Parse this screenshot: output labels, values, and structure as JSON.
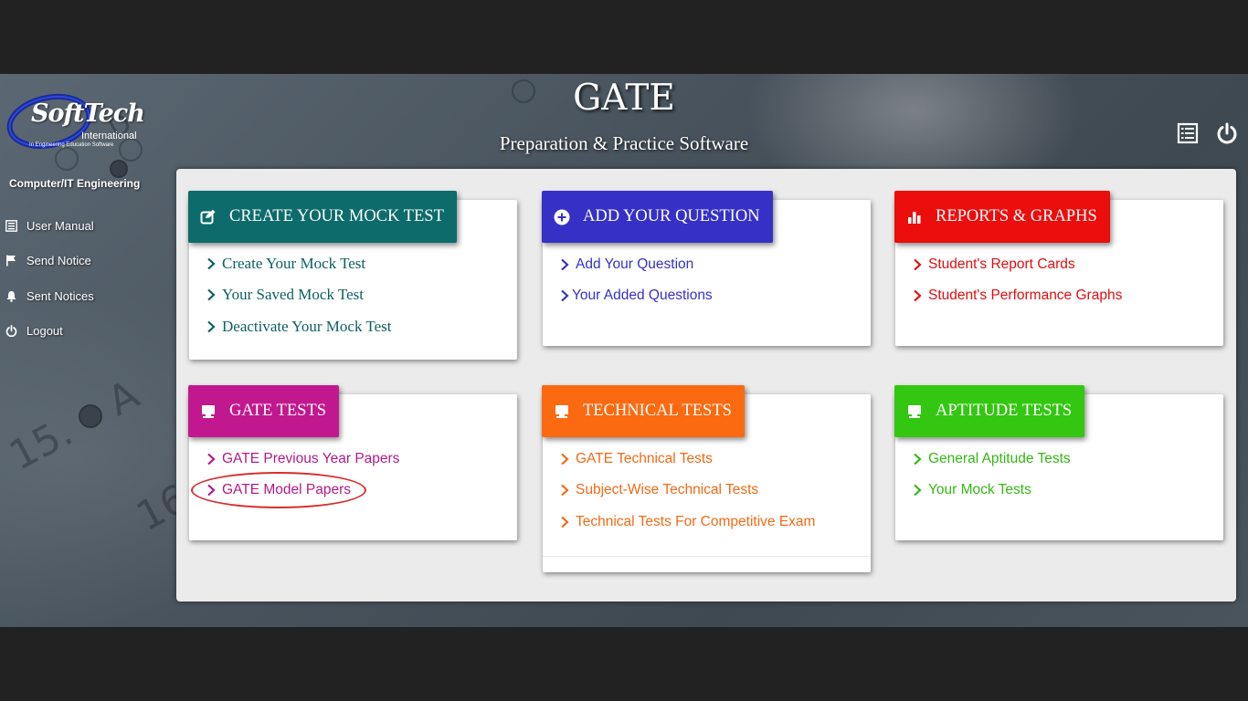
{
  "logo": {
    "title": "SoftTech",
    "subtitle": "International",
    "tagline": "In Engineering Education Software"
  },
  "header": {
    "title": "GATE",
    "subtitle": "Preparation & Practice Software",
    "icons": [
      "list-icon",
      "power-icon"
    ]
  },
  "sidebar": {
    "department": "Computer/IT Engineering",
    "items": [
      {
        "label": "User Manual",
        "icon": "list-icon"
      },
      {
        "label": "Send Notice",
        "icon": "flag-icon"
      },
      {
        "label": "Sent Notices",
        "icon": "bell-icon"
      },
      {
        "label": "Logout",
        "icon": "power-icon"
      }
    ]
  },
  "cards": {
    "mock": {
      "title": "CREATE YOUR MOCK TEST",
      "icon": "edit-icon",
      "color": "#0e6b6b",
      "links": [
        "Create Your Mock Test",
        "Your Saved Mock Test",
        "Deactivate Your Mock Test"
      ]
    },
    "question": {
      "title": "ADD YOUR QUESTION",
      "icon": "plus-circle-icon",
      "color": "#3730c7",
      "links": [
        "Add Your Question",
        "Your Added Questions"
      ]
    },
    "reports": {
      "title": "REPORTS & GRAPHS",
      "icon": "bar-chart-icon",
      "color": "#ec0d0d",
      "links": [
        "Student's Report Cards",
        "Student's Performance Graphs"
      ]
    },
    "gate": {
      "title": "GATE TESTS",
      "icon": "monitor-icon",
      "color": "#c2188f",
      "links": [
        "GATE Previous Year Papers",
        "GATE Model Papers"
      ]
    },
    "technical": {
      "title": "TECHNICAL TESTS",
      "icon": "monitor-icon",
      "color": "#fb6a10",
      "links": [
        "GATE Technical Tests",
        "Subject-Wise Technical Tests",
        "Technical Tests For Competitive Exam"
      ]
    },
    "aptitude": {
      "title": "APTITUDE TESTS",
      "icon": "monitor-icon",
      "color": "#33c711",
      "links": [
        "General Aptitude Tests",
        "Your Mock Tests"
      ]
    }
  },
  "highlight": {
    "color": "#d92b2b",
    "target": "GATE Model Papers"
  }
}
